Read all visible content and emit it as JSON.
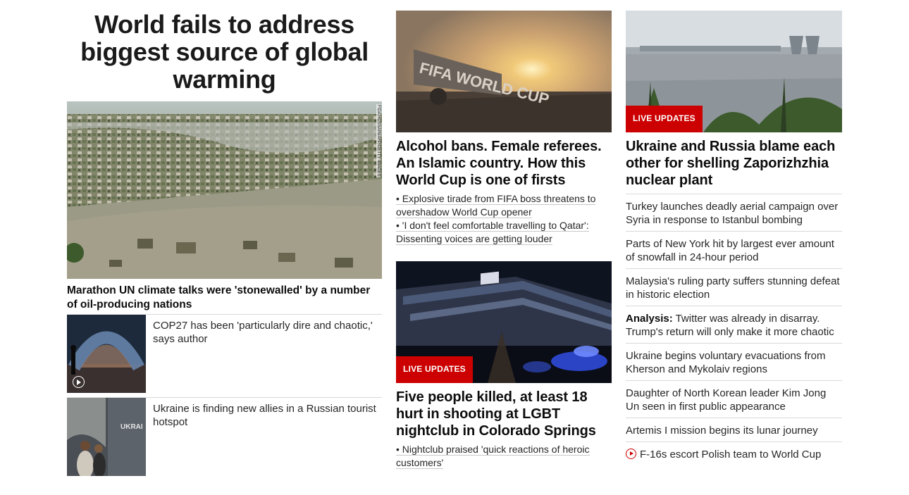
{
  "col1": {
    "headline": "World fails to address biggest source of global warming",
    "hero": {
      "credit": "FIDA HUSSAIN/AFP/GETTY IMAGES",
      "caption": "Marathon UN climate talks were 'stonewalled' by a number of oil-producing nations",
      "image": "flooded-town-aerial"
    },
    "cards": [
      {
        "text": "COP27 has been 'particularly dire and chaotic,' says author",
        "image": "cop27-arch-night",
        "icon": "play-icon"
      },
      {
        "text": "Ukraine is finding new allies in a Russian tourist hotspot",
        "image": "ukraine-exhibit"
      }
    ]
  },
  "col2": {
    "story1": {
      "image": "world-cup-sign-sunset",
      "headline": "Alcohol bans. Female referees. An Islamic country. How this World Cup is one of firsts",
      "bullets": [
        "• Explosive tirade from FIFA boss threatens to overshadow World Cup opener",
        "• 'I don't feel comfortable travelling to Qatar': Dissenting voices are getting louder"
      ]
    },
    "story2": {
      "image": "nightclub-police-night",
      "badge": "LIVE UPDATES",
      "headline": "Five people killed, at least 18 hurt in shooting at LGBT nightclub in Colorado Springs",
      "bullets": [
        "• Nightclub praised 'quick reactions of heroic customers'"
      ]
    }
  },
  "col3": {
    "lead": {
      "image": "nuclear-plant-river",
      "badge": "LIVE UPDATES",
      "headline": "Ukraine and Russia blame each other for shelling Zaporizhzhia nuclear plant"
    },
    "items": [
      {
        "prefix": "",
        "text": "Turkey launches deadly aerial campaign over Syria in response to Istanbul bombing"
      },
      {
        "prefix": "",
        "text": "Parts of New York hit by largest ever amount of snowfall in 24-hour period"
      },
      {
        "prefix": "",
        "text": "Malaysia's ruling party suffers stunning defeat in historic election"
      },
      {
        "prefix": "Analysis:",
        "text": " Twitter was already in disarray. Trump's return will only make it more chaotic"
      },
      {
        "prefix": "",
        "text": "Ukraine begins voluntary evacuations from Kherson and Mykolaiv regions"
      },
      {
        "prefix": "",
        "text": "Daughter of North Korean leader Kim Jong Un seen in first public appearance"
      },
      {
        "prefix": "",
        "text": "Artemis I mission begins its lunar journey"
      },
      {
        "prefix": "",
        "text": "F-16s escort Polish team to World Cup",
        "icon": "video-icon"
      }
    ]
  },
  "colors": {
    "badge": "#cc0000",
    "rule": "#d9d9d9",
    "text": "#262626"
  }
}
